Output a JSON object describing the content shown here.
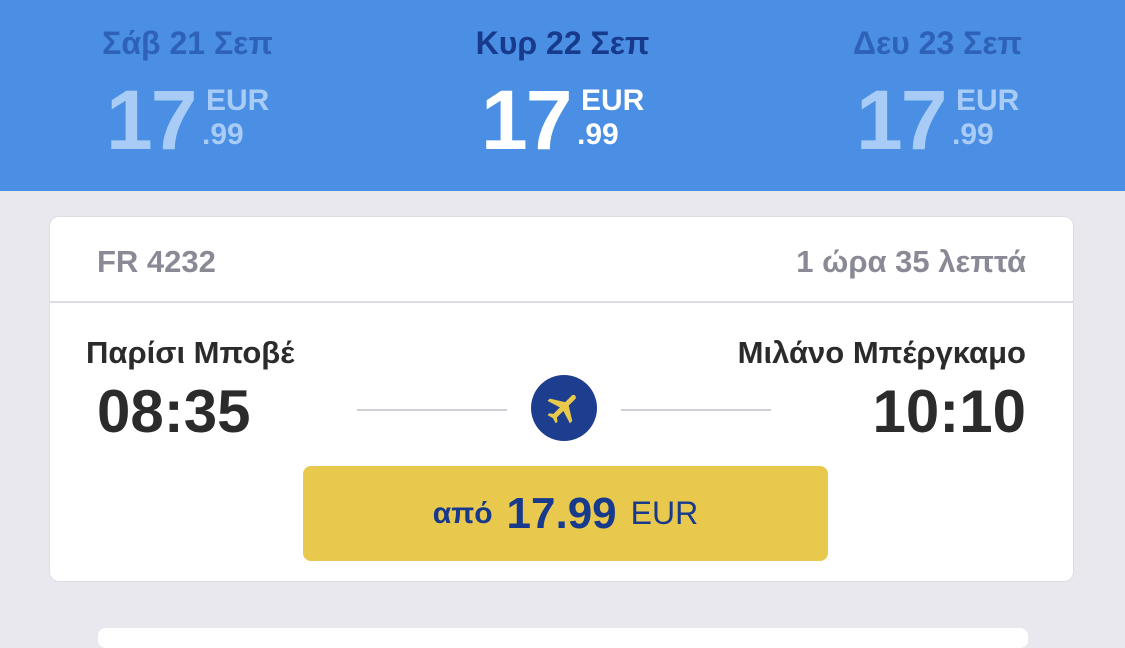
{
  "dates": [
    {
      "label": "Σάβ 21 Σεπ",
      "price_int": "17",
      "currency": "EUR",
      "price_dec": ".99",
      "selected": false
    },
    {
      "label": "Κυρ 22 Σεπ",
      "price_int": "17",
      "currency": "EUR",
      "price_dec": ".99",
      "selected": true
    },
    {
      "label": "Δευ 23 Σεπ",
      "price_int": "17",
      "currency": "EUR",
      "price_dec": ".99",
      "selected": false
    }
  ],
  "flight": {
    "number": "FR 4232",
    "duration": "1 ώρα 35 λεπτά",
    "origin_city": "Παρίσι Μποβέ",
    "departure_time": "08:35",
    "destination_city": "Μιλάνο Μπέργκαμο",
    "arrival_time": "10:10",
    "price_prefix": "από",
    "price_amount": "17.99",
    "price_currency": "EUR"
  },
  "icons": {
    "plane": "airplane-icon"
  },
  "colors": {
    "header_bg": "#4a8fe3",
    "selected_date": "#173a8c",
    "price_button": "#e8c94e",
    "plane_circle": "#1d3d8f",
    "plane_glyph": "#e8c94e"
  }
}
